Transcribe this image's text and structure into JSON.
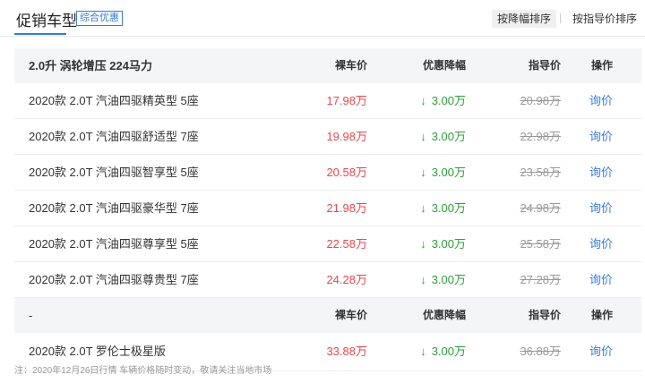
{
  "header": {
    "title": "促销车型",
    "tag": "综合优惠",
    "sort_options": [
      "按降幅排序",
      "按指导价排序"
    ]
  },
  "groups": [
    {
      "name": "2.0升 涡轮增压 224马力",
      "columns": [
        "裸车价",
        "优惠降幅",
        "指导价",
        "操作"
      ],
      "rows": [
        {
          "name": "2020款 2.0T 汽油四驱精英型 5座",
          "price": "17.98万",
          "discount": "3.00万",
          "guide": "20.98万",
          "action": "询价"
        },
        {
          "name": "2020款 2.0T 汽油四驱舒适型 7座",
          "price": "19.98万",
          "discount": "3.00万",
          "guide": "22.98万",
          "action": "询价"
        },
        {
          "name": "2020款 2.0T 汽油四驱智享型 5座",
          "price": "20.58万",
          "discount": "3.00万",
          "guide": "23.58万",
          "action": "询价"
        },
        {
          "name": "2020款 2.0T 汽油四驱豪华型 7座",
          "price": "21.98万",
          "discount": "3.00万",
          "guide": "24.98万",
          "action": "询价"
        },
        {
          "name": "2020款 2.0T 汽油四驱尊享型 5座",
          "price": "22.58万",
          "discount": "3.00万",
          "guide": "25.58万",
          "action": "询价"
        },
        {
          "name": "2020款 2.0T 汽油四驱尊贵型 7座",
          "price": "24.28万",
          "discount": "3.00万",
          "guide": "27.28万",
          "action": "询价"
        }
      ]
    },
    {
      "name": "-",
      "columns": [
        "裸车价",
        "优惠降幅",
        "指导价",
        "操作"
      ],
      "rows": [
        {
          "name": "2020款 2.0T 罗伦士极星版",
          "price": "33.88万",
          "discount": "3.00万",
          "guide": "36.88万",
          "action": "询价"
        }
      ]
    }
  ],
  "note": "注：2020年12月26日行情 车辆价格随时变动，敬请关注当地市场",
  "icons": {
    "discount_arrow": "down-arrow-icon"
  },
  "colors": {
    "accent": "#3a7bd5",
    "price": "#e8474e",
    "discount": "#2e9e3a",
    "muted": "#999999"
  }
}
